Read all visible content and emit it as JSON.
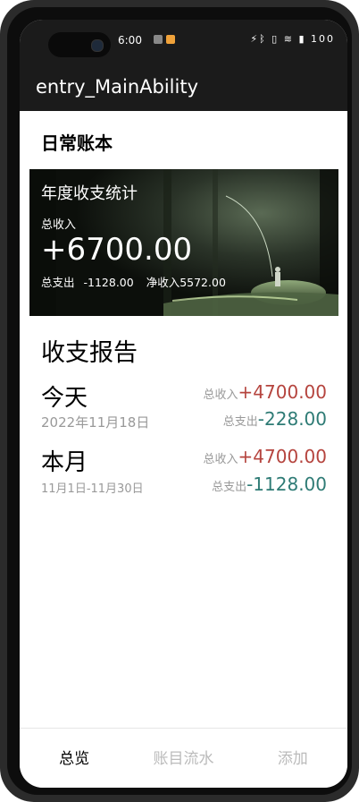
{
  "statusbar": {
    "time": "6:00",
    "right_icons": "⚡ᛒ ▯ ≋ ▮ 100"
  },
  "header": {
    "app_title": "entry_MainAbility"
  },
  "page": {
    "title": "日常账本"
  },
  "banner": {
    "title": "年度收支统计",
    "income_label": "总收入",
    "income_value": "+6700.00",
    "expense_label": "总支出",
    "expense_value": "-1128.00",
    "net_label": "净收入",
    "net_value": "5572.00"
  },
  "report": {
    "title": "收支报告",
    "today": {
      "label": "今天",
      "date": "2022年11月18日",
      "income_label": "总收入",
      "income_value": "+4700.00",
      "expense_label": "总支出",
      "expense_value": "-228.00"
    },
    "month": {
      "label": "本月",
      "date": "11月1日-11月30日",
      "income_label": "总收入",
      "income_value": "+4700.00",
      "expense_label": "总支出",
      "expense_value": "-1128.00"
    }
  },
  "tabs": [
    {
      "label": "总览",
      "active": true
    },
    {
      "label": "账目流水",
      "active": false
    },
    {
      "label": "添加",
      "active": false
    }
  ],
  "colors": {
    "income": "#b5443e",
    "expense": "#2e7b75",
    "bar": "#1b1b1b"
  }
}
